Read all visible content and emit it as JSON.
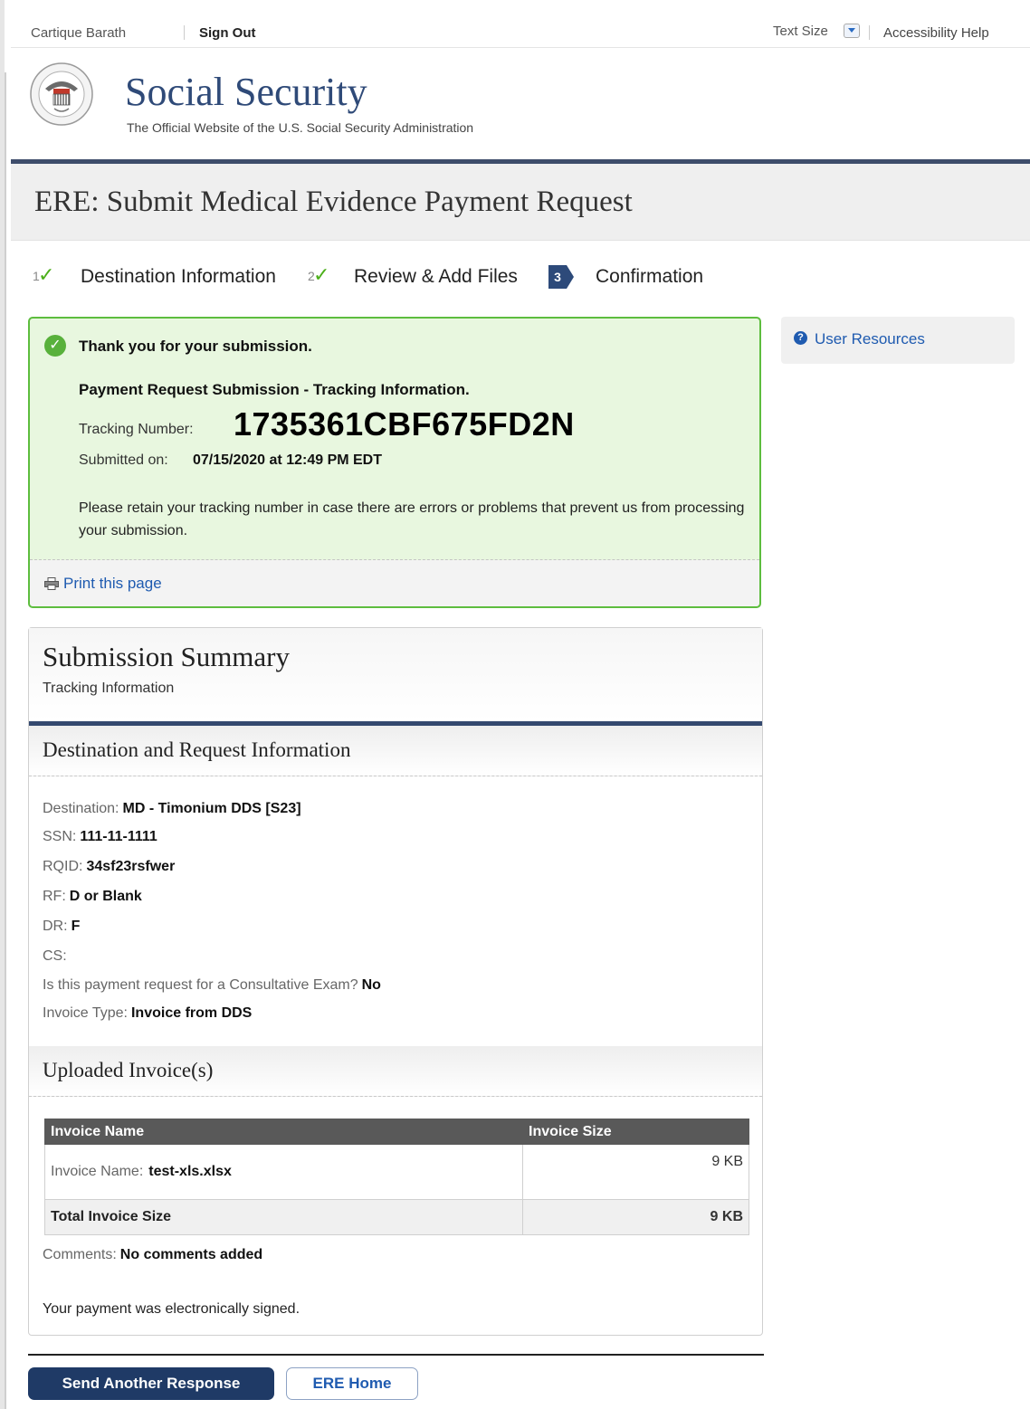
{
  "topbar": {
    "user_name": "Cartique Barath",
    "sign_out": "Sign Out",
    "text_size": "Text Size",
    "accessibility_help": "Accessibility Help"
  },
  "header": {
    "brand": "Social Security",
    "tagline": "The Official Website of the U.S. Social Security Administration"
  },
  "page_title": "ERE: Submit Medical Evidence Payment Request",
  "steps": [
    {
      "number": "1",
      "label": "Destination Information",
      "status": "complete"
    },
    {
      "number": "2",
      "label": "Review & Add Files",
      "status": "complete"
    },
    {
      "number": "3",
      "label": "Confirmation",
      "status": "active"
    }
  ],
  "confirmation": {
    "thanks": "Thank you for your submission.",
    "subhead": "Payment Request Submission - Tracking Information.",
    "tracking_label": "Tracking Number:",
    "tracking_number": "1735361CBF675FD2N",
    "submitted_label": "Submitted on:",
    "submitted_value": "07/15/2020 at 12:49 PM EDT",
    "retain_text": "Please retain your tracking number in case there are errors or problems that prevent us from processing your submission.",
    "print_link": "Print this page"
  },
  "sidebar": {
    "user_resources": "User Resources"
  },
  "summary": {
    "title": "Submission Summary",
    "subtitle": "Tracking Information",
    "destination_section": "Destination and Request Information",
    "fields": [
      {
        "label": "Destination:",
        "value": "MD - Timonium DDS [S23]"
      },
      {
        "label": "SSN:",
        "value": "111-11-1111"
      },
      {
        "label": "RQID:",
        "value": "34sf23rsfwer"
      },
      {
        "label": "RF:",
        "value": "D or Blank"
      },
      {
        "label": "DR:",
        "value": "F"
      },
      {
        "label": "CS:",
        "value": ""
      },
      {
        "label": "Is this payment request for a Consultative Exam?",
        "value": "No"
      },
      {
        "label": "Invoice Type:",
        "value": "Invoice from DDS"
      }
    ],
    "invoices_section": "Uploaded Invoice(s)",
    "invoice_table": {
      "headers": [
        "Invoice Name",
        "Invoice Size"
      ],
      "rows": [
        {
          "label": "Invoice Name:",
          "name": "test-xls.xlsx",
          "size": "9 KB"
        }
      ],
      "total_label": "Total Invoice Size",
      "total_size": "9 KB"
    },
    "comments_label": "Comments:",
    "comments_value": "No comments added",
    "signed_text": "Your payment was electronically signed."
  },
  "actions": {
    "send_another": "Send Another Response",
    "ere_home": "ERE Home"
  },
  "colors": {
    "brand_blue": "#2f4a78",
    "success_border": "#5dbd3e",
    "success_bg": "#e8f7df",
    "link_blue": "#1f5bb0",
    "primary_button": "#1f3a66"
  }
}
